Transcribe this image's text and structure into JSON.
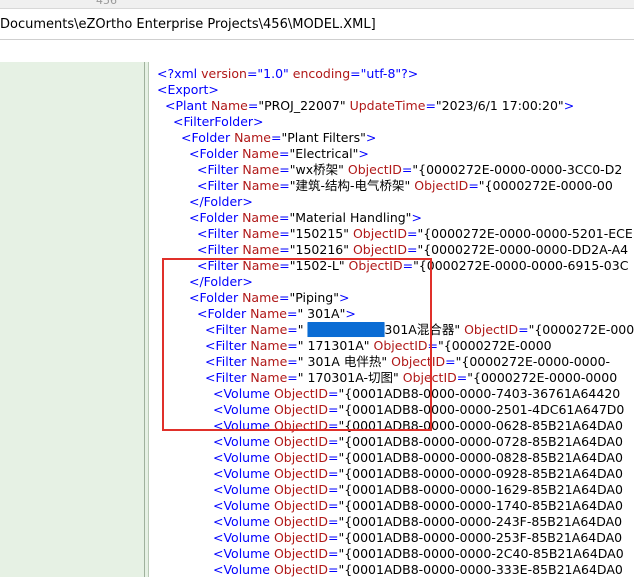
{
  "toolbar": {
    "text": "456"
  },
  "path": {
    "text": "Documents\\eZOrtho Enterprise Projects\\456\\MODEL.XML]"
  },
  "xml_lines": [
    {
      "indent": 8,
      "parts": [
        {
          "c": "b",
          "t": "<?xml "
        },
        {
          "c": "r",
          "t": "version"
        },
        {
          "c": "b",
          "t": "=\"1.0\" "
        },
        {
          "c": "r",
          "t": "encoding"
        },
        {
          "c": "b",
          "t": "=\"utf-8\"?>"
        }
      ]
    },
    {
      "indent": 8,
      "parts": [
        {
          "c": "b",
          "t": "<Export>"
        }
      ]
    },
    {
      "indent": 16,
      "parts": [
        {
          "c": "b",
          "t": "<Plant "
        },
        {
          "c": "r",
          "t": "Name"
        },
        {
          "c": "b",
          "t": "="
        },
        {
          "c": "k",
          "t": "\"PROJ_22007\""
        },
        {
          "c": "r",
          "t": " UpdateTime"
        },
        {
          "c": "b",
          "t": "="
        },
        {
          "c": "k",
          "t": "\"2023/6/1 17:00:20\""
        },
        {
          "c": "b",
          "t": ">"
        }
      ]
    },
    {
      "indent": 24,
      "parts": [
        {
          "c": "b",
          "t": "<FilterFolder>"
        }
      ]
    },
    {
      "indent": 32,
      "parts": [
        {
          "c": "b",
          "t": "<Folder "
        },
        {
          "c": "r",
          "t": "Name"
        },
        {
          "c": "b",
          "t": "="
        },
        {
          "c": "k",
          "t": "\"Plant Filters\""
        },
        {
          "c": "b",
          "t": ">"
        }
      ]
    },
    {
      "indent": 40,
      "parts": [
        {
          "c": "b",
          "t": "<Folder "
        },
        {
          "c": "r",
          "t": "Name"
        },
        {
          "c": "b",
          "t": "="
        },
        {
          "c": "k",
          "t": "\"Electrical\""
        },
        {
          "c": "b",
          "t": ">"
        }
      ]
    },
    {
      "indent": 48,
      "parts": [
        {
          "c": "b",
          "t": "<Filter "
        },
        {
          "c": "r",
          "t": "Name"
        },
        {
          "c": "b",
          "t": "="
        },
        {
          "c": "k",
          "t": "\"wx桥架\""
        },
        {
          "c": "r",
          "t": " ObjectID"
        },
        {
          "c": "b",
          "t": "="
        },
        {
          "c": "k",
          "t": "\"{0000272E-0000-0000-3CC0-D2"
        }
      ]
    },
    {
      "indent": 48,
      "parts": [
        {
          "c": "b",
          "t": "<Filter "
        },
        {
          "c": "r",
          "t": "Name"
        },
        {
          "c": "b",
          "t": "="
        },
        {
          "c": "k",
          "t": "\"建筑-结构-电气桥架\""
        },
        {
          "c": "r",
          "t": " ObjectID"
        },
        {
          "c": "b",
          "t": "="
        },
        {
          "c": "k",
          "t": "\"{0000272E-0000-00"
        }
      ]
    },
    {
      "indent": 40,
      "parts": [
        {
          "c": "b",
          "t": "</Folder>"
        }
      ]
    },
    {
      "indent": 40,
      "parts": [
        {
          "c": "b",
          "t": "<Folder "
        },
        {
          "c": "r",
          "t": "Name"
        },
        {
          "c": "b",
          "t": "="
        },
        {
          "c": "k",
          "t": "\"Material Handling\""
        },
        {
          "c": "b",
          "t": ">"
        }
      ]
    },
    {
      "indent": 48,
      "parts": [
        {
          "c": "b",
          "t": "<Filter "
        },
        {
          "c": "r",
          "t": "Name"
        },
        {
          "c": "b",
          "t": "="
        },
        {
          "c": "k",
          "t": "\"150215\""
        },
        {
          "c": "r",
          "t": " ObjectID"
        },
        {
          "c": "b",
          "t": "="
        },
        {
          "c": "k",
          "t": "\"{0000272E-0000-0000-5201-ECE"
        }
      ]
    },
    {
      "indent": 48,
      "parts": [
        {
          "c": "b",
          "t": "<Filter "
        },
        {
          "c": "r",
          "t": "Name"
        },
        {
          "c": "b",
          "t": "="
        },
        {
          "c": "k",
          "t": "\"150216\""
        },
        {
          "c": "r",
          "t": " ObjectID"
        },
        {
          "c": "b",
          "t": "="
        },
        {
          "c": "k",
          "t": "\"{0000272E-0000-0000-DD2A-A4"
        }
      ]
    },
    {
      "indent": 48,
      "parts": [
        {
          "c": "b",
          "t": "<Filter "
        },
        {
          "c": "r",
          "t": "Name"
        },
        {
          "c": "b",
          "t": "="
        },
        {
          "c": "k",
          "t": "\"1502-L\""
        },
        {
          "c": "r",
          "t": " ObjectID"
        },
        {
          "c": "b",
          "t": "="
        },
        {
          "c": "k",
          "t": "\"{0000272E-0000-0000-6915-03C"
        }
      ]
    },
    {
      "indent": 40,
      "parts": [
        {
          "c": "b",
          "t": "</Folder>"
        }
      ]
    },
    {
      "indent": 40,
      "parts": [
        {
          "c": "b",
          "t": "<Folder "
        },
        {
          "c": "r",
          "t": "Name"
        },
        {
          "c": "b",
          "t": "="
        },
        {
          "c": "k",
          "t": "\"Piping\""
        },
        {
          "c": "b",
          "t": ">"
        }
      ]
    },
    {
      "indent": 48,
      "parts": [
        {
          "c": "b",
          "t": "<Folder "
        },
        {
          "c": "r",
          "t": "Name"
        },
        {
          "c": "b",
          "t": "="
        },
        {
          "c": "k",
          "t": "\"    301A\""
        },
        {
          "c": "b",
          "t": ">"
        }
      ]
    },
    {
      "indent": 56,
      "parts": [
        {
          "c": "b",
          "t": "<Filter "
        },
        {
          "c": "r",
          "t": "Name"
        },
        {
          "c": "b",
          "t": "="
        },
        {
          "c": "k",
          "t": "\"  "
        },
        {
          "c": "sel",
          "t": "████████"
        },
        {
          "c": "k",
          "t": "301A混合器\""
        },
        {
          "c": "r",
          "t": " ObjectID"
        },
        {
          "c": "b",
          "t": "="
        },
        {
          "c": "k",
          "t": "\"{0000272E-0000"
        }
      ]
    },
    {
      "indent": 56,
      "parts": [
        {
          "c": "b",
          "t": "<Filter "
        },
        {
          "c": "r",
          "t": "Name"
        },
        {
          "c": "b",
          "t": "="
        },
        {
          "c": "k",
          "t": "\"          171301A\""
        },
        {
          "c": "r",
          "t": " ObjectID"
        },
        {
          "c": "b",
          "t": "="
        },
        {
          "c": "k",
          "t": "\"{0000272E-0000"
        }
      ]
    },
    {
      "indent": 56,
      "parts": [
        {
          "c": "b",
          "t": "<Filter "
        },
        {
          "c": "r",
          "t": "Name"
        },
        {
          "c": "b",
          "t": "="
        },
        {
          "c": "k",
          "t": "\"    301A 电伴热\""
        },
        {
          "c": "r",
          "t": " ObjectID"
        },
        {
          "c": "b",
          "t": "="
        },
        {
          "c": "k",
          "t": "\"{0000272E-0000-0000-"
        }
      ]
    },
    {
      "indent": 56,
      "parts": [
        {
          "c": "b",
          "t": "<Filter "
        },
        {
          "c": "r",
          "t": "Name"
        },
        {
          "c": "b",
          "t": "="
        },
        {
          "c": "k",
          "t": "\"   170301A-切图\""
        },
        {
          "c": "r",
          "t": " ObjectID"
        },
        {
          "c": "b",
          "t": "="
        },
        {
          "c": "k",
          "t": "\"{0000272E-0000-0000"
        }
      ]
    },
    {
      "indent": 64,
      "parts": [
        {
          "c": "b",
          "t": "<Volume "
        },
        {
          "c": "r",
          "t": "ObjectID"
        },
        {
          "c": "b",
          "t": "="
        },
        {
          "c": "k",
          "t": "\"{0001ADB8-0000-0000-7403-36761A64420"
        }
      ]
    },
    {
      "indent": 64,
      "parts": [
        {
          "c": "b",
          "t": "<Volume "
        },
        {
          "c": "r",
          "t": "ObjectID"
        },
        {
          "c": "b",
          "t": "="
        },
        {
          "c": "k",
          "t": "\"{0001ADB8-0000-0000-2501-4DC61A647D0"
        }
      ]
    },
    {
      "indent": 64,
      "parts": [
        {
          "c": "b",
          "t": "<Volume "
        },
        {
          "c": "r",
          "t": "ObjectID"
        },
        {
          "c": "b",
          "t": "="
        },
        {
          "c": "k",
          "t": "\"{0001ADB8-0000-0000-0628-85B21A64DA0"
        }
      ]
    },
    {
      "indent": 64,
      "parts": [
        {
          "c": "b",
          "t": "<Volume "
        },
        {
          "c": "r",
          "t": "ObjectID"
        },
        {
          "c": "b",
          "t": "="
        },
        {
          "c": "k",
          "t": "\"{0001ADB8-0000-0000-0728-85B21A64DA0"
        }
      ]
    },
    {
      "indent": 64,
      "parts": [
        {
          "c": "b",
          "t": "<Volume "
        },
        {
          "c": "r",
          "t": "ObjectID"
        },
        {
          "c": "b",
          "t": "="
        },
        {
          "c": "k",
          "t": "\"{0001ADB8-0000-0000-0828-85B21A64DA0"
        }
      ]
    },
    {
      "indent": 64,
      "parts": [
        {
          "c": "b",
          "t": "<Volume "
        },
        {
          "c": "r",
          "t": "ObjectID"
        },
        {
          "c": "b",
          "t": "="
        },
        {
          "c": "k",
          "t": "\"{0001ADB8-0000-0000-0928-85B21A64DA0"
        }
      ]
    },
    {
      "indent": 64,
      "parts": [
        {
          "c": "b",
          "t": "<Volume "
        },
        {
          "c": "r",
          "t": "ObjectID"
        },
        {
          "c": "b",
          "t": "="
        },
        {
          "c": "k",
          "t": "\"{0001ADB8-0000-0000-1629-85B21A64DA0"
        }
      ]
    },
    {
      "indent": 64,
      "parts": [
        {
          "c": "b",
          "t": "<Volume "
        },
        {
          "c": "r",
          "t": "ObjectID"
        },
        {
          "c": "b",
          "t": "="
        },
        {
          "c": "k",
          "t": "\"{0001ADB8-0000-0000-1740-85B21A64DA0"
        }
      ]
    },
    {
      "indent": 64,
      "parts": [
        {
          "c": "b",
          "t": "<Volume "
        },
        {
          "c": "r",
          "t": "ObjectID"
        },
        {
          "c": "b",
          "t": "="
        },
        {
          "c": "k",
          "t": "\"{0001ADB8-0000-0000-243F-85B21A64DA0"
        }
      ]
    },
    {
      "indent": 64,
      "parts": [
        {
          "c": "b",
          "t": "<Volume "
        },
        {
          "c": "r",
          "t": "ObjectID"
        },
        {
          "c": "b",
          "t": "="
        },
        {
          "c": "k",
          "t": "\"{0001ADB8-0000-0000-253F-85B21A64DA0"
        }
      ]
    },
    {
      "indent": 64,
      "parts": [
        {
          "c": "b",
          "t": "<Volume "
        },
        {
          "c": "r",
          "t": "ObjectID"
        },
        {
          "c": "b",
          "t": "="
        },
        {
          "c": "k",
          "t": "\"{0001ADB8-0000-0000-2C40-85B21A64DA0"
        }
      ]
    },
    {
      "indent": 64,
      "parts": [
        {
          "c": "b",
          "t": "<Volume "
        },
        {
          "c": "r",
          "t": "ObjectID"
        },
        {
          "c": "b",
          "t": "="
        },
        {
          "c": "k",
          "t": "\"{0001ADB8-0000-0000-333E-85B21A64DA0"
        }
      ]
    }
  ]
}
